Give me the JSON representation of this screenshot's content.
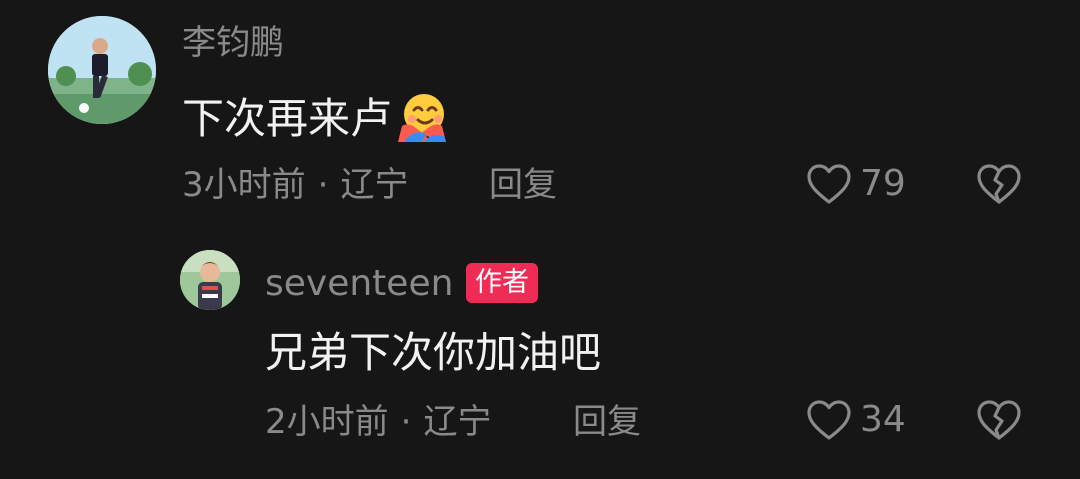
{
  "comments": [
    {
      "username": "李钧鹏",
      "text": "下次再来卢",
      "emoji_icon": "hugging-face-emoji",
      "time": "3小时前",
      "separator": "·",
      "location": "辽宁",
      "reply_label": "回复",
      "likes": "79"
    }
  ],
  "reply": {
    "username": "seventeen",
    "badge": "作者",
    "text": "兄弟下次你加油吧",
    "time": "2小时前",
    "separator": "·",
    "location": "辽宁",
    "reply_label": "回复",
    "likes": "34"
  },
  "colors": {
    "background": "#161616",
    "secondary_text": "#8a8a8a",
    "primary_text": "#f2f2f2",
    "author_badge": "#f02c56"
  }
}
